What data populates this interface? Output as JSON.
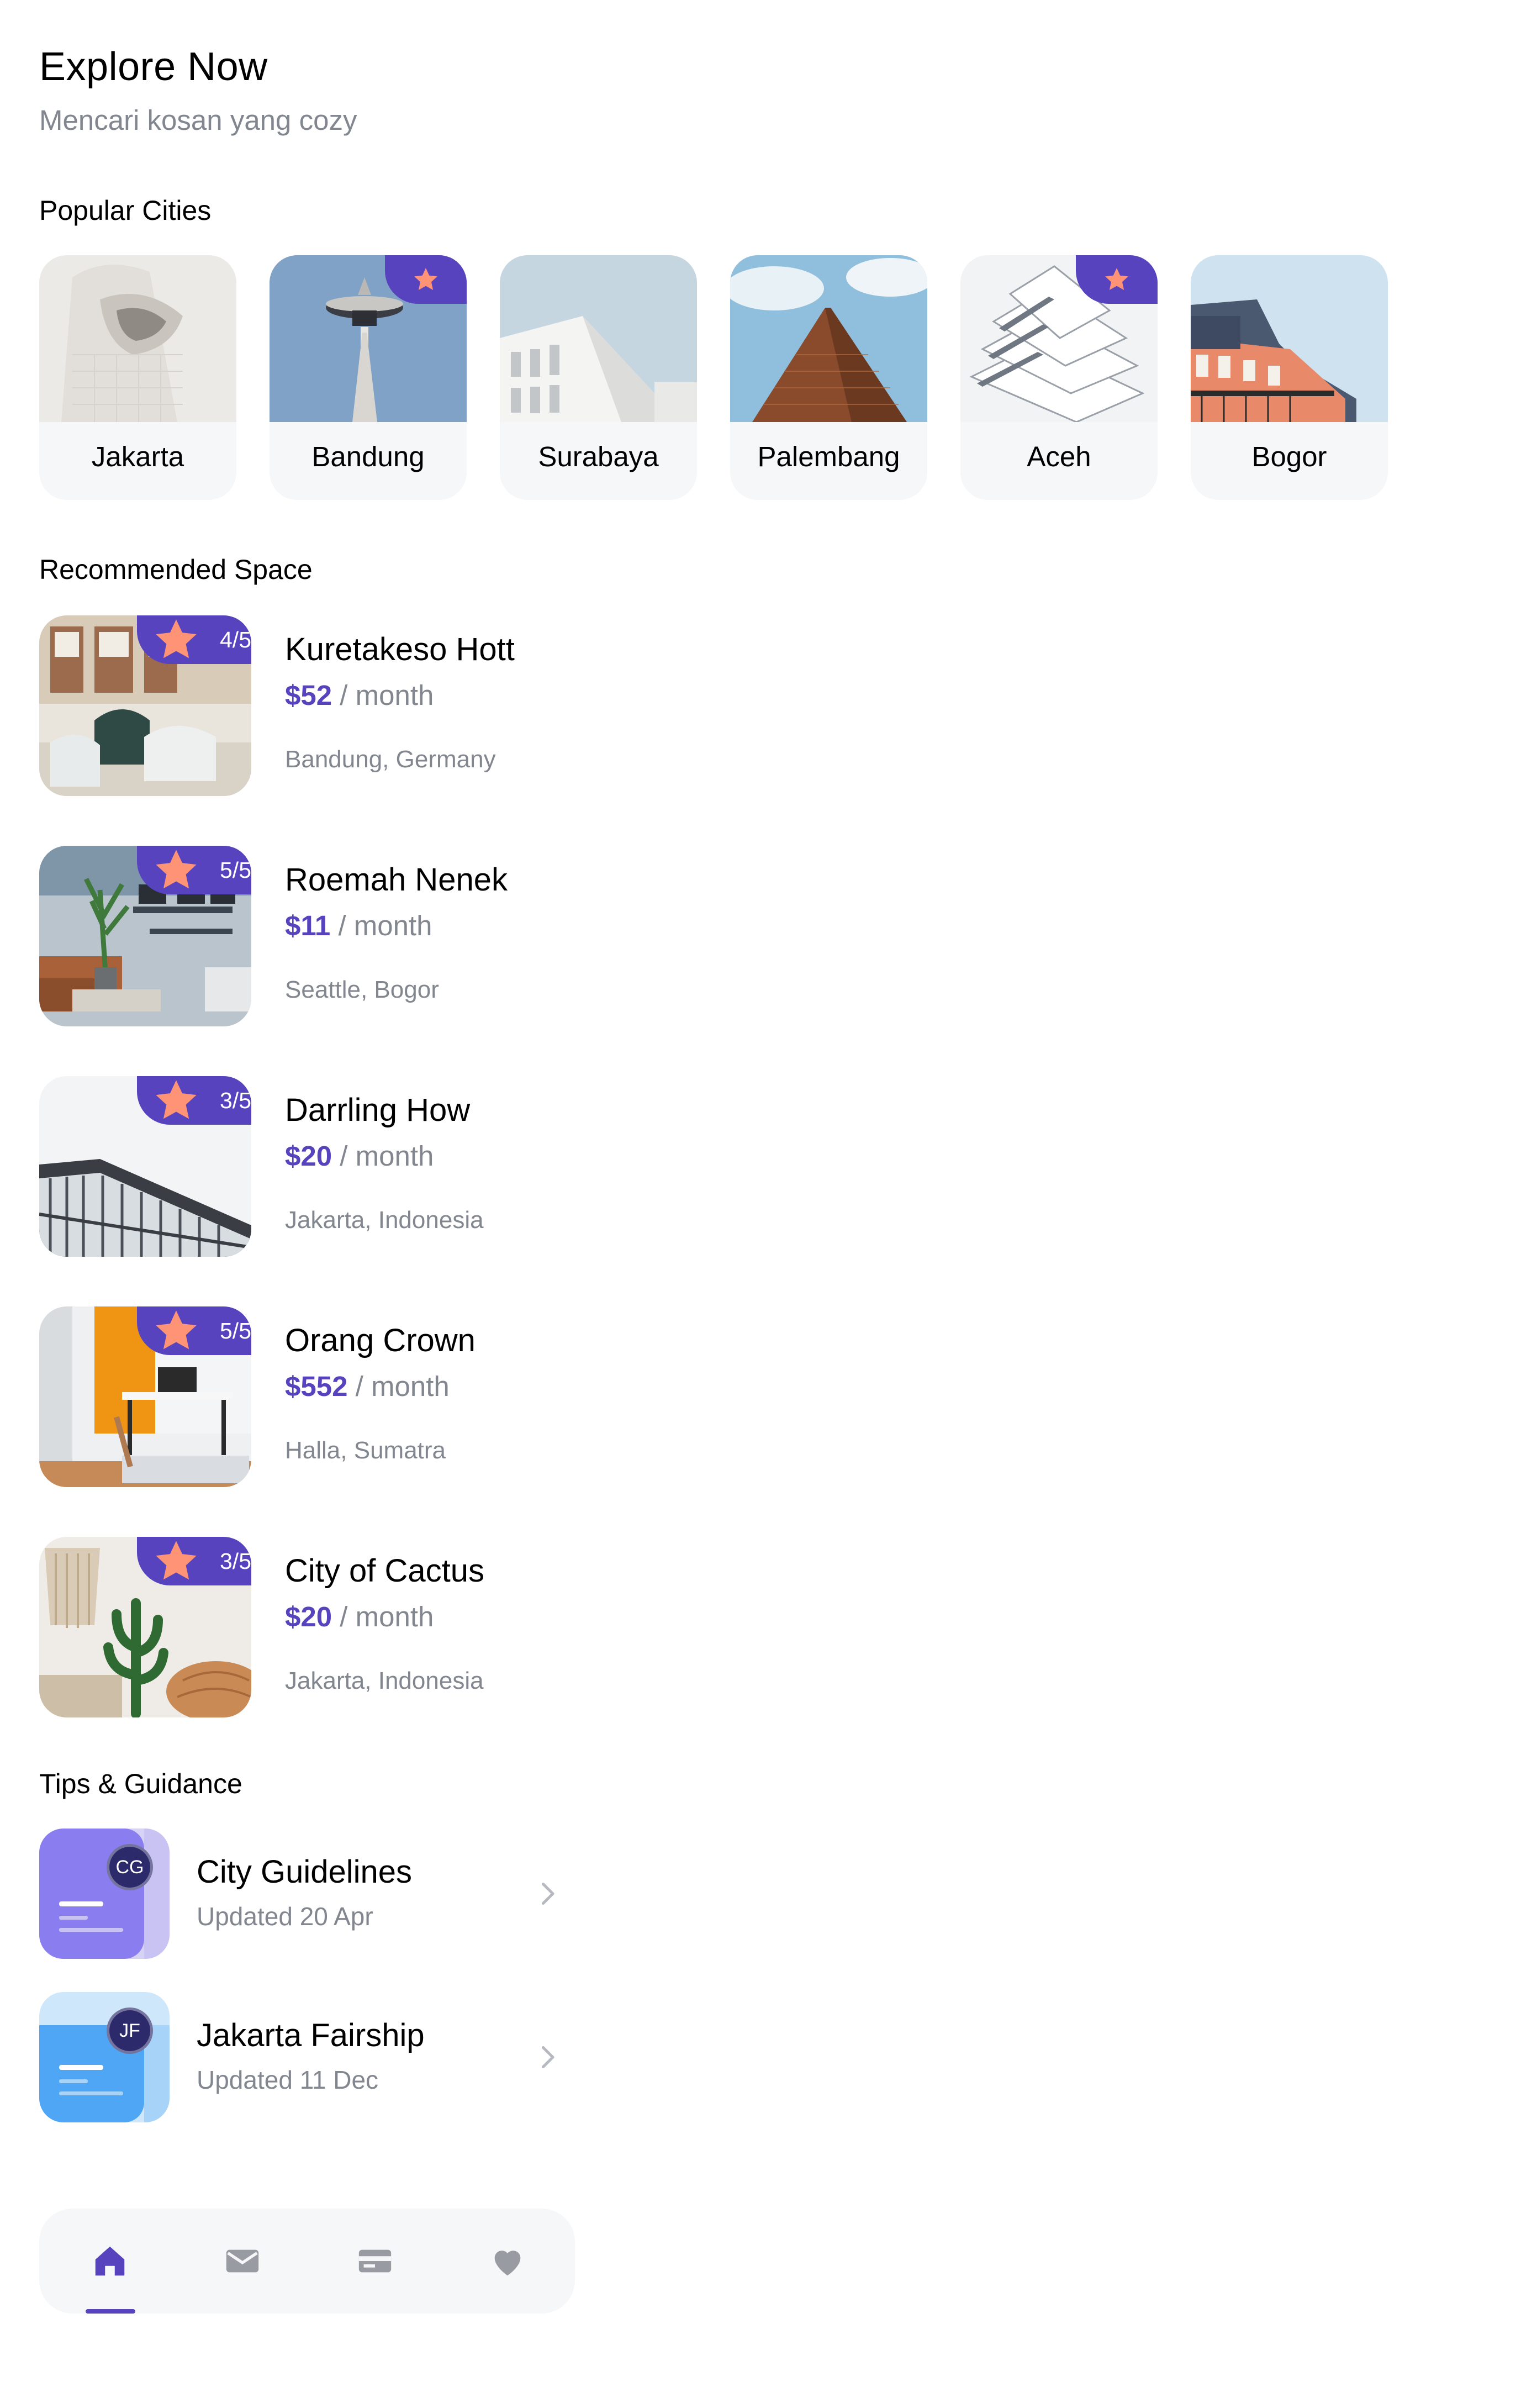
{
  "header": {
    "title": "Explore Now",
    "subtitle": "Mencari kosan yang cozy"
  },
  "popular": {
    "title": "Popular Cities",
    "cities": [
      {
        "name": "Jakarta",
        "featured": false
      },
      {
        "name": "Bandung",
        "featured": true
      },
      {
        "name": "Surabaya",
        "featured": false
      },
      {
        "name": "Palembang",
        "featured": false
      },
      {
        "name": "Aceh",
        "featured": true
      },
      {
        "name": "Bogor",
        "featured": false
      }
    ]
  },
  "recommended": {
    "title": "Recommended Space",
    "spaces": [
      {
        "name": "Kuretakeso Hott",
        "price": "$52",
        "unit": "/ month",
        "location": "Bandung, Germany",
        "rating": "4/5"
      },
      {
        "name": "Roemah Nenek",
        "price": "$11",
        "unit": "/ month",
        "location": "Seattle, Bogor",
        "rating": "5/5"
      },
      {
        "name": "Darrling How",
        "price": "$20",
        "unit": "/ month",
        "location": "Jakarta, Indonesia",
        "rating": "3/5"
      },
      {
        "name": "Orang Crown",
        "price": "$552",
        "unit": "/ month",
        "location": "Halla, Sumatra",
        "rating": "5/5"
      },
      {
        "name": "City of Cactus",
        "price": "$20",
        "unit": "/ month",
        "location": "Jakarta, Indonesia",
        "rating": "3/5"
      }
    ]
  },
  "tips": {
    "title": "Tips & Guidance",
    "items": [
      {
        "name": "City Guidelines",
        "updated": "Updated 20 Apr",
        "initials": "CG"
      },
      {
        "name": "Jakarta Fairship",
        "updated": "Updated 11 Dec",
        "initials": "JF"
      }
    ]
  },
  "nav": {
    "items": [
      "home-icon",
      "mail-icon",
      "card-icon",
      "heart-icon"
    ],
    "active": "home-icon"
  },
  "colors": {
    "primary": "#5843be",
    "star": "#ff9376",
    "muted": "#82868e",
    "surface": "#f6f7f8"
  }
}
